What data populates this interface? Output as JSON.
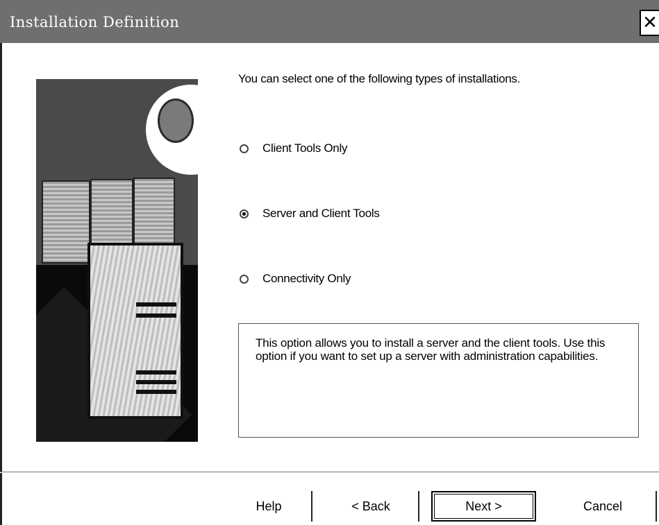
{
  "window": {
    "title": "Installation Definition",
    "close_label": "✕"
  },
  "main": {
    "instructions": "You can select one of the following types of installations.",
    "options": [
      {
        "label": "Client Tools Only",
        "checked": false
      },
      {
        "label": "Server and Client Tools",
        "checked": true
      },
      {
        "label": "Connectivity Only",
        "checked": false
      }
    ],
    "description": "This option allows you to install a server and the client tools. Use this option if you want to set up a server with administration capabilities."
  },
  "buttons": {
    "help": "Help",
    "back": "< Back",
    "next": "Next >",
    "cancel": "Cancel"
  },
  "colors": {
    "titlebar": "#6f6f6f",
    "title_text": "#ffffff",
    "background": "#ffffff"
  },
  "icons": {
    "close": "close-icon",
    "side_art": "server-illustration"
  }
}
